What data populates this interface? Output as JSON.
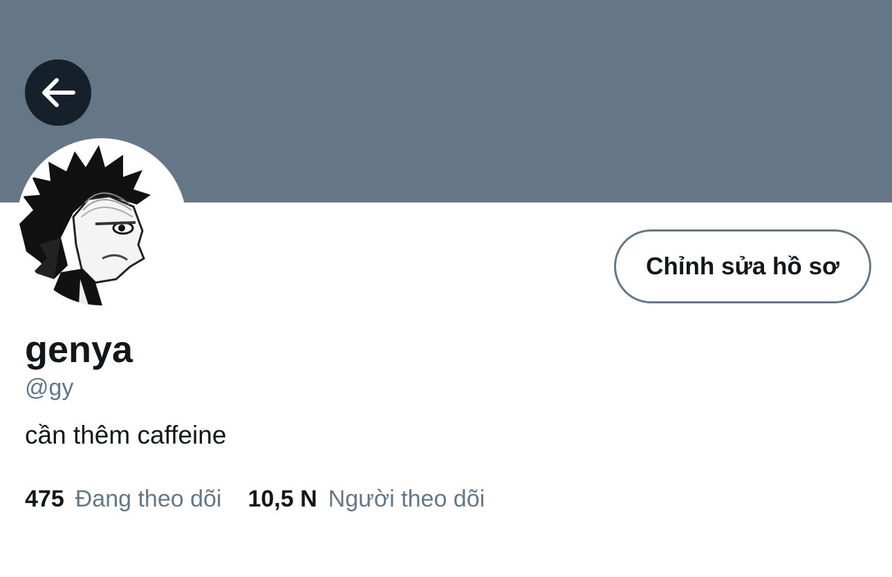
{
  "header": {
    "back_icon": "arrow-left-icon",
    "banner_color": "#657786"
  },
  "profile": {
    "display_name": "genya",
    "handle": "@gy",
    "bio": "cần thêm caffeine",
    "edit_button_label": "Chỉnh sửa hồ sơ"
  },
  "stats": {
    "following_count": "475",
    "following_label": "Đang theo dõi",
    "followers_count": "10,5 N",
    "followers_label": "Người theo dõi"
  },
  "colors": {
    "text_primary": "#14171a",
    "text_secondary": "#657786",
    "back_button_bg": "#15202b"
  }
}
